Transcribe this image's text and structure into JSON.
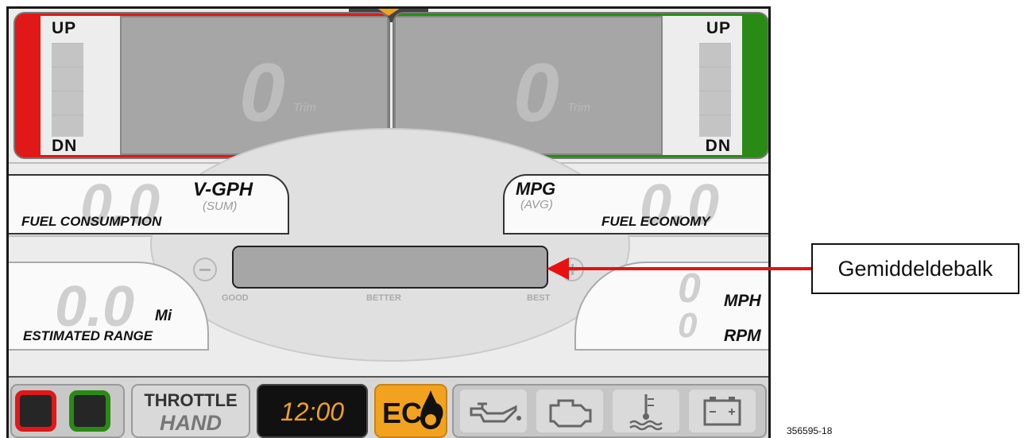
{
  "trim": {
    "left": {
      "up_label": "UP",
      "down_label": "DN",
      "value": "0",
      "unit": "Trim"
    },
    "right": {
      "up_label": "UP",
      "down_label": "DN",
      "value": "0",
      "unit": "Trim"
    }
  },
  "fuel_consumption": {
    "value": "0.0",
    "unit": "V-GPH",
    "mode": "(SUM)",
    "label": "FUEL CONSUMPTION"
  },
  "fuel_economy": {
    "value": "0.0",
    "unit": "MPG",
    "mode": "(AVG)",
    "label": "FUEL ECONOMY"
  },
  "efficiency_bar": {
    "level": 0,
    "scale_good": "GOOD",
    "scale_better": "BETTER",
    "scale_best": "BEST"
  },
  "estimated_range": {
    "value": "0.0",
    "unit": "Mi",
    "label": "ESTIMATED RANGE"
  },
  "speed": {
    "mph_value": "0",
    "mph_unit": "MPH",
    "rpm_value": "0",
    "rpm_unit": "RPM"
  },
  "bottom_bar": {
    "throttle_line1": "THROTTLE",
    "throttle_line2": "HAND",
    "clock": "12:00",
    "eco_label": "ECO",
    "icons": [
      "oil-pressure-icon",
      "check-engine-icon",
      "coolant-temperature-icon",
      "battery-icon"
    ]
  },
  "annotation": {
    "callout": "Gemiddeldebalk",
    "figure_id": "356595-18"
  },
  "colors": {
    "port": "#e01818",
    "starboard": "#2a8a16",
    "eco": "#f2a21e",
    "clock_text": "#f0a020",
    "arrow": "#e81010"
  }
}
